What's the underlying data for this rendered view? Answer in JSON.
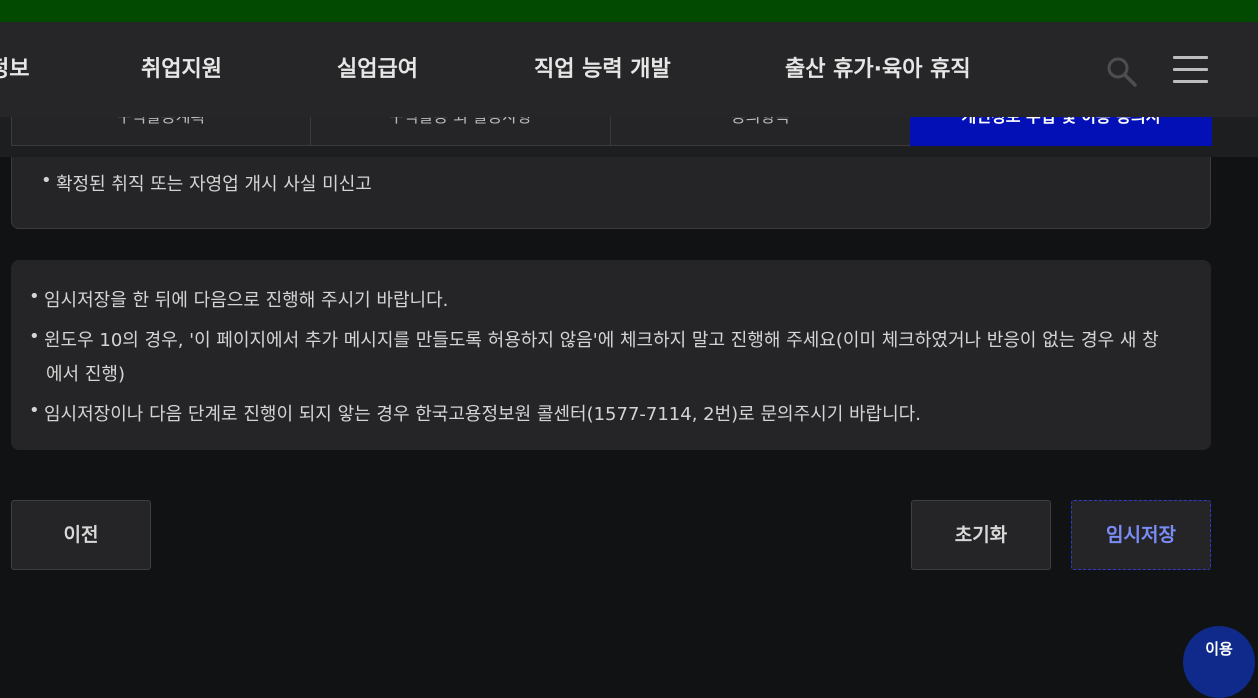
{
  "header": {
    "nav": [
      {
        "label": "정보"
      },
      {
        "label": "취업지원"
      },
      {
        "label": "실업급여"
      },
      {
        "label": "직업 능력 개발"
      },
      {
        "label": "출산 휴가·육아 휴직"
      }
    ],
    "icons": {
      "search": "search-icon",
      "menu": "hamburger-menu-icon"
    }
  },
  "tabs": [
    {
      "label": "구직활동계획",
      "active": false
    },
    {
      "label": "구직활동 외 활동사항",
      "active": false
    },
    {
      "label": "동의항목",
      "active": false
    },
    {
      "label": "개인정보 수집 및 이용 동의서",
      "active": true
    }
  ],
  "box1": {
    "items": [
      "확정된 취직 또는 자영업 개시 사실 미신고"
    ]
  },
  "notice": {
    "bullet": "•",
    "items": [
      {
        "text": "임시저장을 한 뒤에 다음으로 진행해 주시기 바랍니다."
      },
      {
        "text": "윈도우 10의 경우, '이 페이지에서 추가 메시지를 만들도록 허용하지 않음'에 체크하지 말고 진행해 주세요(이미 체크하였거나 반응이 없는 경우 새 창",
        "cont": "에서 진행)"
      },
      {
        "text": "임시저장이나 다음 단계로 진행이 되지 앟는 경우 한국고용정보원 콜센터(1577-7114, 2번)로 문의주시기 바랍니다."
      }
    ]
  },
  "buttons": {
    "prev": "이전",
    "reset": "초기화",
    "save": "임시저장"
  },
  "chat": {
    "label": "이용"
  },
  "colors": {
    "topbar": "#024a02",
    "header_bg": "#262628",
    "page_bg": "#111214",
    "active_tab": "#0310b5",
    "primary_text": "#7a8cf5"
  }
}
